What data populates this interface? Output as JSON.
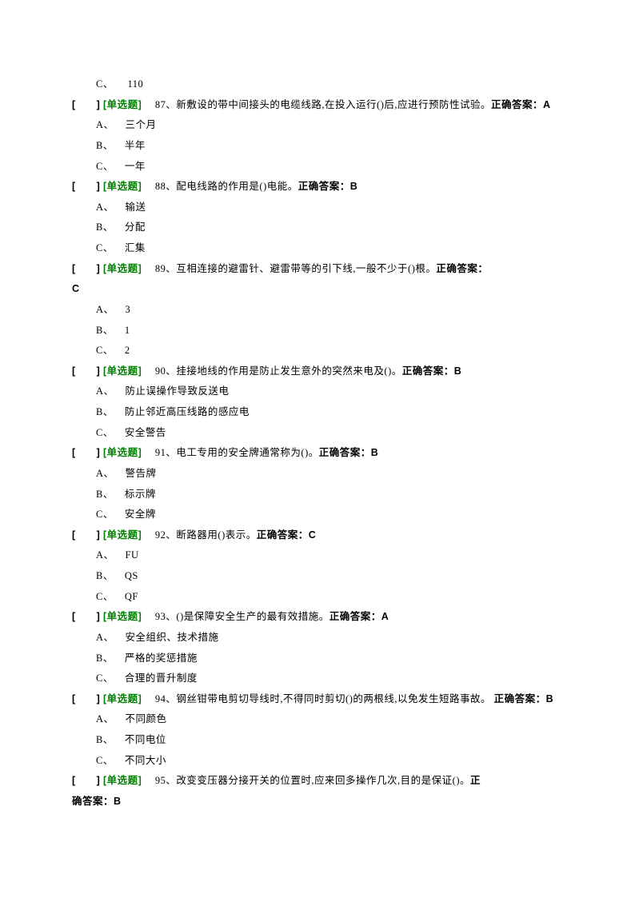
{
  "orphan_option": {
    "letter": "C、",
    "text": "110"
  },
  "questions": [
    {
      "num": "87",
      "text": "、新敷设的带中间接头的电缆线路,在投入运行()后,应进行预防性试验。",
      "answer_label": "正确答案：A",
      "options": [
        {
          "letter": "A、",
          "text": "三个月"
        },
        {
          "letter": "B、",
          "text": "半年"
        },
        {
          "letter": "C、",
          "text": "一年"
        }
      ]
    },
    {
      "num": "88",
      "text": "、配电线路的作用是()电能。",
      "answer_label": "正确答案：B",
      "options": [
        {
          "letter": "A、",
          "text": "输送"
        },
        {
          "letter": "B、",
          "text": "分配"
        },
        {
          "letter": "C、",
          "text": "汇集"
        }
      ]
    },
    {
      "num": "89",
      "text": "、互相连接的避雷针、避雷带等的引下线,一般不少于()根。",
      "answer_label": "正确答案：C",
      "answer_newline": true,
      "options": [
        {
          "letter": "A、",
          "text": "3"
        },
        {
          "letter": "B、",
          "text": "1"
        },
        {
          "letter": "C、",
          "text": "2"
        }
      ]
    },
    {
      "num": "90",
      "text": "、挂接地线的作用是防止发生意外的突然来电及()。",
      "answer_label": "正确答案：B",
      "options": [
        {
          "letter": "A、",
          "text": "防止误操作导致反送电"
        },
        {
          "letter": "B、",
          "text": "防止邻近高压线路的感应电"
        },
        {
          "letter": "C、",
          "text": "安全警告"
        }
      ]
    },
    {
      "num": "91",
      "text": "、电工专用的安全牌通常称为()。",
      "answer_label": "正确答案：B",
      "options": [
        {
          "letter": "A、",
          "text": "警告牌"
        },
        {
          "letter": "B、",
          "text": "标示牌"
        },
        {
          "letter": "C、",
          "text": "安全牌"
        }
      ]
    },
    {
      "num": "92",
      "text": "、断路器用()表示。",
      "answer_label": "正确答案：C",
      "options": [
        {
          "letter": "A、",
          "text": "FU"
        },
        {
          "letter": "B、",
          "text": "QS"
        },
        {
          "letter": "C、",
          "text": "QF"
        }
      ]
    },
    {
      "num": "93",
      "text": "、()是保障安全生产的最有效措施。",
      "answer_label": "正确答案：A",
      "options": [
        {
          "letter": "A、",
          "text": "安全组织、技术措施"
        },
        {
          "letter": "B、",
          "text": "严格的奖惩措施"
        },
        {
          "letter": "C、",
          "text": "合理的晋升制度"
        }
      ]
    },
    {
      "num": "94",
      "text": "、钢丝钳带电剪切导线时,不得同时剪切()的两根线,以免发生短路事故。 ",
      "answer_label": "正确答案：B",
      "answer_after_break": true,
      "options": [
        {
          "letter": "A、",
          "text": "不同颜色"
        },
        {
          "letter": "B、",
          "text": "不同电位"
        },
        {
          "letter": "C、",
          "text": "不同大小"
        }
      ]
    },
    {
      "num": "95",
      "text": "、改变变压器分接开关的位置时,应来回多操作几次,目的是保证()。",
      "answer_label": "正确答案：B",
      "answer_newline": true,
      "options": []
    }
  ],
  "labels": {
    "bracket": "[　　]",
    "tag": "[单选题]"
  }
}
